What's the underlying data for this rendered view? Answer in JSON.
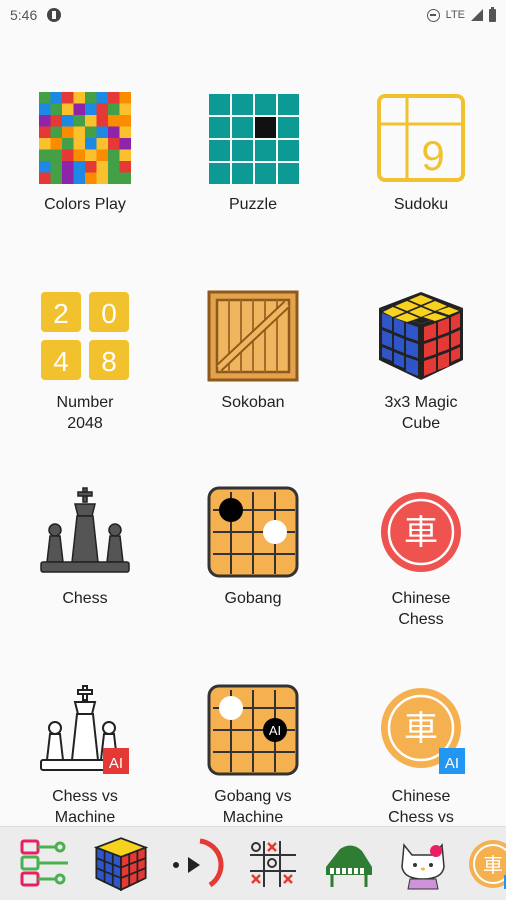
{
  "status_bar": {
    "time": "5:46",
    "network": "LTE"
  },
  "apps": [
    {
      "label": "Colors Play",
      "icon": "colorful-grid-icon"
    },
    {
      "label": "Puzzle",
      "icon": "sliding-puzzle-icon"
    },
    {
      "label": "Sudoku",
      "icon": "sudoku-icon"
    },
    {
      "label": "Number 2048",
      "icon": "number-2048-icon"
    },
    {
      "label": "Sokoban",
      "icon": "wooden-crate-icon"
    },
    {
      "label": "3x3 Magic Cube",
      "icon": "rubik-cube-icon"
    },
    {
      "label": "Chess",
      "icon": "chess-pieces-icon"
    },
    {
      "label": "Gobang",
      "icon": "gobang-board-icon"
    },
    {
      "label": "Chinese Chess",
      "icon": "chinese-chess-icon"
    },
    {
      "label": "Chess vs Machine",
      "icon": "chess-ai-icon"
    },
    {
      "label": "Gobang vs Machine",
      "icon": "gobang-ai-icon"
    },
    {
      "label": "Chinese Chess vs",
      "icon": "chinese-chess-ai-icon"
    }
  ],
  "icon_text": {
    "sudoku_digit": "9",
    "n2048": [
      "2",
      "0",
      "4",
      "8"
    ],
    "chinese_char": "車",
    "ai": "AI"
  },
  "bottom_bar": [
    {
      "icon": "flowchart-icon"
    },
    {
      "icon": "rubik-cube-icon"
    },
    {
      "icon": "dial-icon"
    },
    {
      "icon": "tic-tac-toe-icon"
    },
    {
      "icon": "piano-icon"
    },
    {
      "icon": "kitty-icon"
    },
    {
      "icon": "chinese-chess-icon"
    }
  ],
  "colors": {
    "accent_yellow": "#f2c12e",
    "teal": "#0e9a94",
    "red": "#ef5350",
    "gold": "#f5b04f",
    "ai_red": "#e53935",
    "ai_blue": "#2196f3"
  }
}
